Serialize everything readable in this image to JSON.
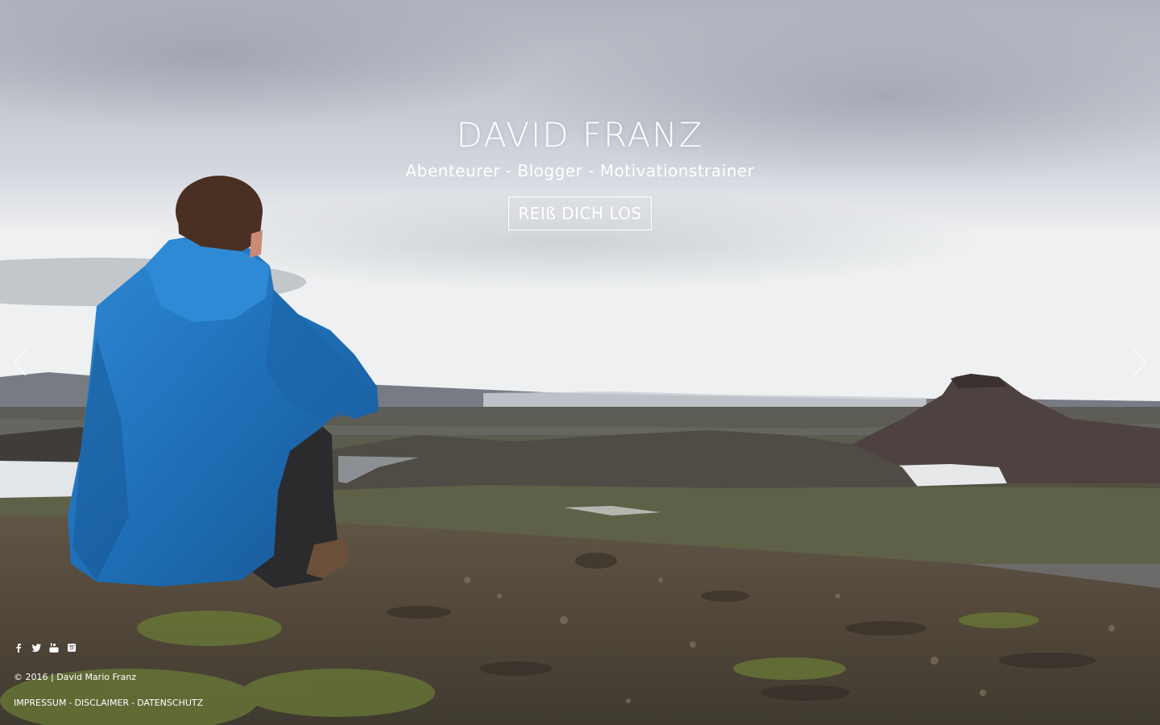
{
  "hero": {
    "title": "DAVID FRANZ",
    "tagline": "Abenteurer - Blogger - Motivationstrainer",
    "cta_label": "REIß DICH LOS"
  },
  "slider": {
    "prev_icon": "chevron-left-icon",
    "next_icon": "chevron-right-icon"
  },
  "social": {
    "icons": [
      "facebook-icon",
      "twitter-icon",
      "youtube-icon",
      "instagram-icon"
    ]
  },
  "footer": {
    "copyright": "© 2016 | David Mario Franz",
    "links": {
      "impressum": "IMPRESSUM",
      "disclaimer": "DISCLAIMER",
      "datenschutz": "DATENSCHUTZ",
      "separator": "-"
    }
  },
  "colors": {
    "text": "#ffffff",
    "jacket": "#1f6fb7",
    "sky": "#c9ced8"
  }
}
